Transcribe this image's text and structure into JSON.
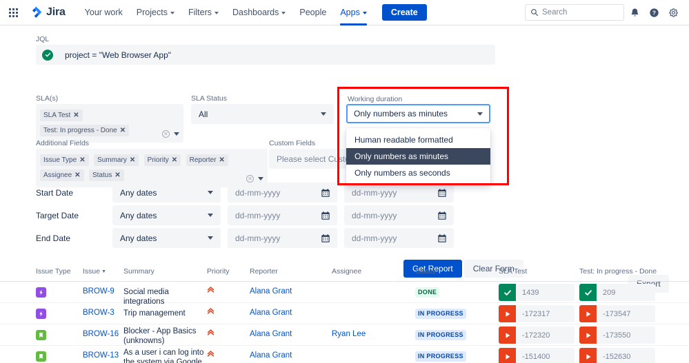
{
  "nav": {
    "apps_grid": "apps-grid",
    "brand": "Jira",
    "items": [
      {
        "label": "Your work",
        "caret": false,
        "active": false
      },
      {
        "label": "Projects",
        "caret": true,
        "active": false
      },
      {
        "label": "Filters",
        "caret": true,
        "active": false
      },
      {
        "label": "Dashboards",
        "caret": true,
        "active": false
      },
      {
        "label": "People",
        "caret": false,
        "active": false
      },
      {
        "label": "Apps",
        "caret": true,
        "active": true
      }
    ],
    "create_label": "Create",
    "search_placeholder": "Search",
    "icons": [
      "notifications-icon",
      "help-icon",
      "settings-icon"
    ]
  },
  "form": {
    "jql": {
      "label": "JQL",
      "value": "project = \"Web Browser App\"",
      "valid": true
    },
    "sla": {
      "label": "SLA(s)",
      "tags": [
        "SLA Test",
        "Test: In progress - Done"
      ]
    },
    "sla_status": {
      "label": "SLA Status",
      "value": "All"
    },
    "working_duration": {
      "label": "Working duration",
      "value": "Only numbers as minutes",
      "options": [
        "Human readable formatted",
        "Only numbers as minutes",
        "Only numbers as seconds"
      ],
      "selected_index": 1
    },
    "additional_fields": {
      "label": "Additional Fields",
      "tags": [
        "Issue Type",
        "Summary",
        "Priority",
        "Reporter",
        "Assignee",
        "Status"
      ]
    },
    "custom_fields": {
      "label": "Custom Fields",
      "placeholder": "Please select Custom fields"
    },
    "date_rows": [
      {
        "label": "Start Date",
        "select": "Any dates",
        "from": "dd-mm-yyyy",
        "to": "dd-mm-yyyy"
      },
      {
        "label": "Target Date",
        "select": "Any dates",
        "from": "dd-mm-yyyy",
        "to": "dd-mm-yyyy"
      },
      {
        "label": "End Date",
        "select": "Any dates",
        "from": "dd-mm-yyyy",
        "to": "dd-mm-yyyy"
      }
    ],
    "buttons": {
      "get_report": "Get Report",
      "clear_form": "Clear Form",
      "export": "Export"
    }
  },
  "table": {
    "columns": [
      "Issue Type",
      "Issue",
      "Summary",
      "Priority",
      "Reporter",
      "Assignee",
      "Status",
      "SLA Test",
      "Test: In progress - Done"
    ],
    "sorted_column": "Issue",
    "rows": [
      {
        "issue_type": "epic",
        "issue": "BROW-9",
        "summary": "Social media integrations",
        "priority": "highest",
        "reporter": "Alana Grant",
        "assignee": "",
        "status": "DONE",
        "status_kind": "done",
        "sla_test": {
          "value": "1439",
          "kind": "ok"
        },
        "test_in_progress_done": {
          "value": "209",
          "kind": "ok"
        }
      },
      {
        "issue_type": "epic",
        "issue": "BROW-3",
        "summary": "Trip management",
        "priority": "highest",
        "reporter": "Alana Grant",
        "assignee": "",
        "status": "IN PROGRESS",
        "status_kind": "inprogress",
        "sla_test": {
          "value": "-172317",
          "kind": "bad"
        },
        "test_in_progress_done": {
          "value": "-173547",
          "kind": "bad"
        }
      },
      {
        "issue_type": "story",
        "issue": "BROW-16",
        "summary": "Blocker - App Basics (unknowns)",
        "priority": "highest",
        "reporter": "Alana Grant",
        "assignee": "Ryan Lee",
        "status": "IN PROGRESS",
        "status_kind": "inprogress",
        "sla_test": {
          "value": "-172320",
          "kind": "bad"
        },
        "test_in_progress_done": {
          "value": "-173550",
          "kind": "bad"
        }
      },
      {
        "issue_type": "story",
        "issue": "BROW-13",
        "summary": "As a user i can log into the system via Google",
        "priority": "highest",
        "reporter": "Alana Grant",
        "assignee": "",
        "status": "IN PROGRESS",
        "status_kind": "inprogress",
        "sla_test": {
          "value": "-151400",
          "kind": "bad"
        },
        "test_in_progress_done": {
          "value": "-152630",
          "kind": "bad"
        }
      }
    ]
  },
  "annotation": {
    "highlight_color": "#ff0000",
    "target": "working-duration-dropdown"
  },
  "colors": {
    "brand_blue": "#0052cc",
    "link_blue": "#0052cc",
    "green": "#00875a",
    "red": "#e8411c",
    "epic_purple": "#904ee2",
    "story_green": "#65ba43",
    "field_bg": "#f4f5f7"
  }
}
